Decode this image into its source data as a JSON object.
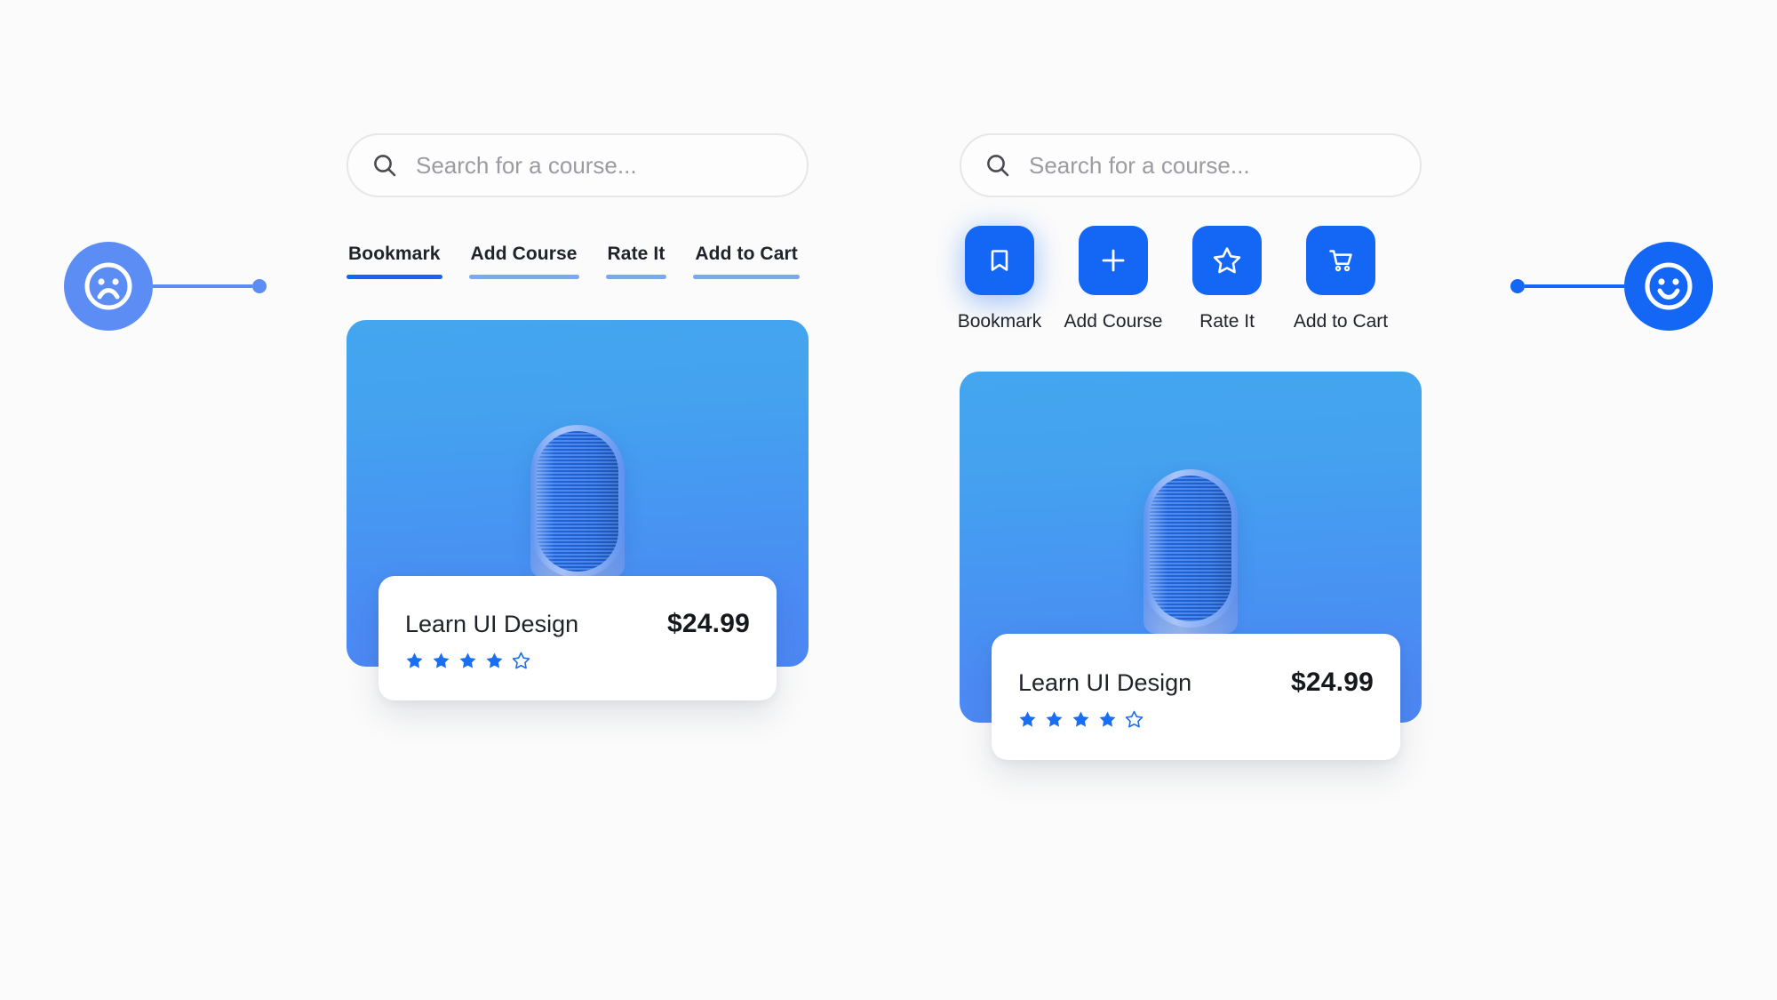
{
  "theme": {
    "background": "#fbfbfb",
    "accent_blue": "#1467f5",
    "accent_blue_light": "#5b8df5",
    "underline_active": "#1366f2",
    "underline_inactive": "#7ba7f5",
    "star_blue": "#1a6ff0",
    "text_dark": "#20232a",
    "placeholder_gray": "#9b9ba1"
  },
  "mood": {
    "left": {
      "icon": "sad-face-icon",
      "label": ""
    },
    "right": {
      "icon": "happy-face-icon",
      "label": ""
    }
  },
  "search": {
    "placeholder": "Search for a course...",
    "value": "",
    "icon": "search-icon"
  },
  "left_panel": {
    "nav_style": "text-links",
    "items": [
      {
        "label": "Bookmark",
        "active": true
      },
      {
        "label": "Add Course",
        "active": false
      },
      {
        "label": "Rate It",
        "active": false
      },
      {
        "label": "Add to Cart",
        "active": false
      }
    ]
  },
  "right_panel": {
    "nav_style": "icon-buttons",
    "items": [
      {
        "label": "Bookmark",
        "icon": "bookmark-icon",
        "active": true
      },
      {
        "label": "Add Course",
        "icon": "plus-icon",
        "active": false
      },
      {
        "label": "Rate It",
        "icon": "star-icon",
        "active": false
      },
      {
        "label": "Add to Cart",
        "icon": "cart-icon",
        "active": false
      }
    ]
  },
  "product": {
    "title": "Learn UI Design",
    "price": "$24.99",
    "rating": 4,
    "rating_max": 5,
    "thumbnail_alt": "abstract-blue-pillar-illustration"
  }
}
